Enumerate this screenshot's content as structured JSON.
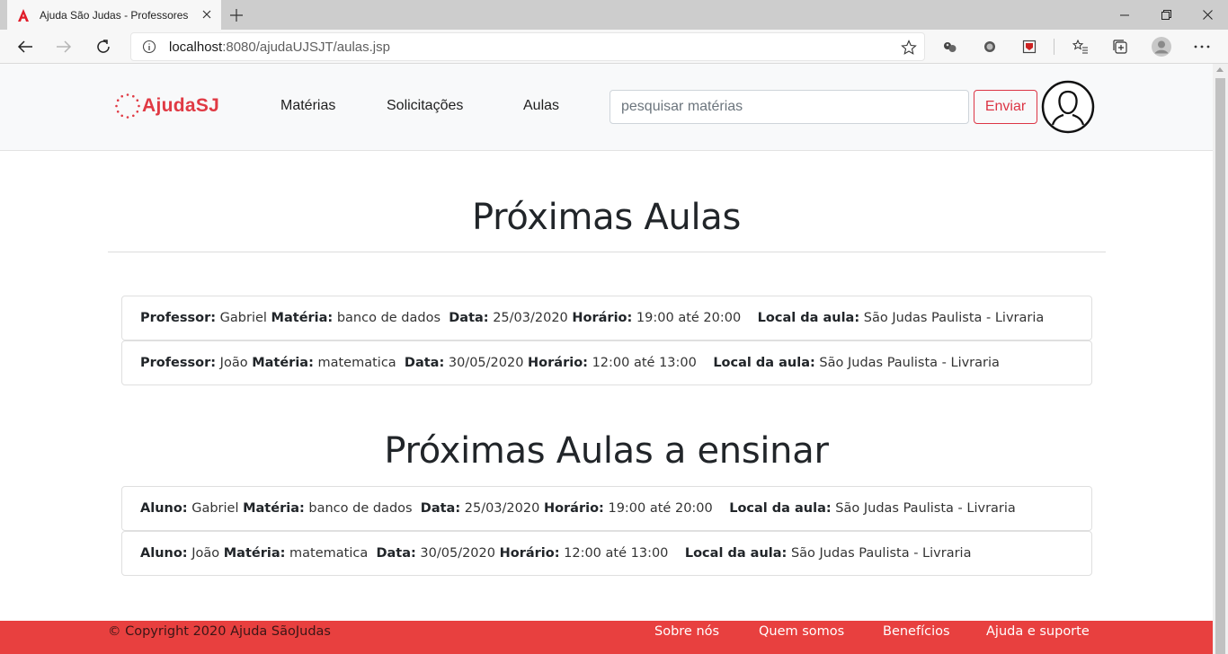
{
  "browser": {
    "tab_title": "Ajuda São Judas - Professores",
    "url_host": "localhost",
    "url_rest": ":8080/ajudaUJSJT/aulas.jsp"
  },
  "navbar": {
    "brand": "AjudaSJ",
    "links": [
      "Matérias",
      "Solicitações",
      "Aulas"
    ],
    "search_placeholder": "pesquisar matérias",
    "send_label": "Enviar"
  },
  "labels": {
    "professor": "Professor:",
    "aluno": "Aluno:",
    "materia": "Matéria:",
    "data": "Data:",
    "horario": "Horário:",
    "local": "Local da aula:"
  },
  "upcoming": {
    "title": "Próximas Aulas",
    "items": [
      {
        "person": "Gabriel",
        "subject": "banco de dados",
        "date": "25/03/2020",
        "time": "19:00 até 20:00",
        "place": "São Judas Paulista - Livraria"
      },
      {
        "person": "João",
        "subject": "matematica",
        "date": "30/05/2020",
        "time": "12:00 até 13:00",
        "place": "São Judas Paulista - Livraria"
      }
    ]
  },
  "teaching": {
    "title": "Próximas Aulas a ensinar",
    "items": [
      {
        "person": "Gabriel",
        "subject": "banco de dados",
        "date": "25/03/2020",
        "time": "19:00 até 20:00",
        "place": "São Judas Paulista - Livraria"
      },
      {
        "person": "João",
        "subject": "matematica",
        "date": "30/05/2020",
        "time": "12:00 até 13:00",
        "place": "São Judas Paulista - Livraria"
      }
    ]
  },
  "footer": {
    "copyright": "© Copyright 2020 Ajuda SãoJudas",
    "links": [
      "Sobre nós",
      "Quem somos",
      "Benefícios",
      "Ajuda e suporte"
    ]
  },
  "colors": {
    "brand": "#e03a44",
    "footer": "#e8403f",
    "button": "#dc3545"
  }
}
